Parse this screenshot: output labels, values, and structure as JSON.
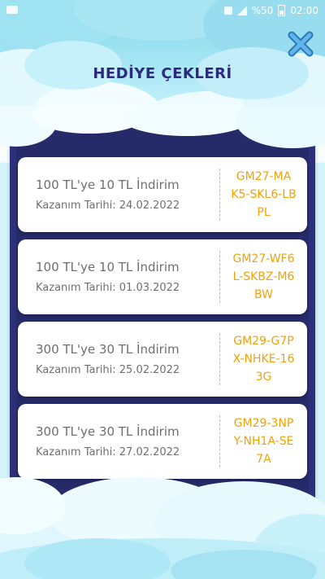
{
  "status_bar": {
    "battery": "%50",
    "time": "02:00"
  },
  "page": {
    "title": "HEDİYE ÇEKLERİ"
  },
  "colors": {
    "title": "#2b2a7c",
    "panel": "#2c2f7a",
    "code": "#f0a20a",
    "text": "#6f6f6f",
    "sky": "#d4f4fb"
  },
  "icons": {
    "close": "close-icon"
  },
  "coupons": [
    {
      "title": "100 TL'ye 10 TL İndirim",
      "date": "Kazanım Tarihi: 24.02.2022",
      "code_lines": [
        "GM27-MA",
        "K5-SKL6-LB",
        "PL"
      ]
    },
    {
      "title": "100 TL'ye 10 TL İndirim",
      "date": "Kazanım Tarihi: 01.03.2022",
      "code_lines": [
        "GM27-WF6",
        "L-SKBZ-M6",
        "BW"
      ]
    },
    {
      "title": "300 TL'ye 30 TL İndirim",
      "date": "Kazanım Tarihi: 25.02.2022",
      "code_lines": [
        "GM29-G7P",
        "X-NHKE-16",
        "3G"
      ]
    },
    {
      "title": "300 TL'ye 30 TL İndirim",
      "date": "Kazanım Tarihi: 27.02.2022",
      "code_lines": [
        "GM29-3NP",
        "Y-NH1A-SE",
        "7A"
      ]
    }
  ]
}
